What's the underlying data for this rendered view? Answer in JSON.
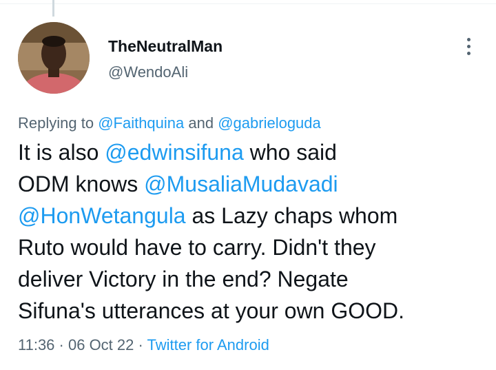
{
  "tweet": {
    "display_name": "TheNeutralMan",
    "handle": "@WendoAli",
    "reply": {
      "prefix": "Replying to ",
      "mention1": "@Faithquina",
      "conjunction": " and ",
      "mention2": "@gabrieloguda"
    },
    "text": {
      "l1_a": "It is also ",
      "l1_mention": "@edwinsifuna",
      "l1_b": " who said",
      "l2_a": "ODM knows ",
      "l2_mention": "@MusaliaMudavadi",
      "l3_mention": "@HonWetangula",
      "l3_b": " as Lazy chaps whom",
      "l4": "Ruto would have to carry. Didn't they",
      "l5": "deliver Victory in the end? Negate",
      "l6": "Sifuna's utterances at your own GOOD."
    },
    "time": "11:36",
    "separator": " · ",
    "date": "06 Oct 22",
    "source": "Twitter for Android"
  },
  "colors": {
    "link": "#1d9bf0",
    "secondary_text": "#536471",
    "primary_text": "#0f1419"
  },
  "icons": {
    "more": "vertical-ellipsis-icon"
  }
}
